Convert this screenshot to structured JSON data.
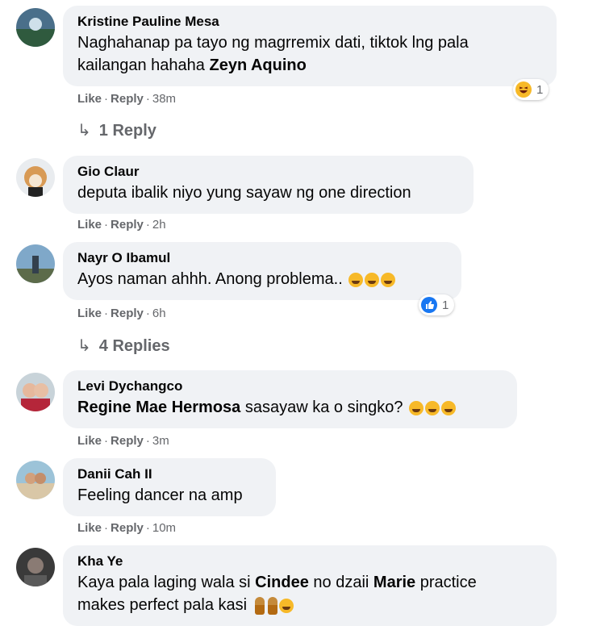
{
  "comments": [
    {
      "author": "Kristine Pauline Mesa",
      "text_line1": "Naghahanap pa tayo ng magrremix dati, tiktok lng pala",
      "text_line2": "kailangan hahaha",
      "mention": "Zeyn Aquino",
      "like": "Like",
      "reply": "Reply",
      "time": "38m",
      "reaction": {
        "icon": "haha-reaction-icon",
        "count": "1"
      },
      "replies": "1 Reply"
    },
    {
      "author": "Gio Claur",
      "text": "deputa ibalik niyo yung sayaw ng one direction",
      "like": "Like",
      "reply": "Reply",
      "time": "2h"
    },
    {
      "author": "Nayr O Ibamul",
      "text": "Ayos naman ahhh. Anong problema..",
      "emojis": [
        "thinking-face",
        "thinking-face",
        "thinking-face"
      ],
      "like": "Like",
      "reply": "Reply",
      "time": "6h",
      "reaction": {
        "icon": "like-reaction-icon",
        "count": "1"
      },
      "replies": "4 Replies"
    },
    {
      "author": "Levi Dychangco",
      "mention": "Regine Mae Hermosa",
      "text": "sasayaw ka o singko?",
      "emojis": [
        "rolling-laughing",
        "rolling-laughing",
        "rolling-laughing"
      ],
      "like": "Like",
      "reply": "Reply",
      "time": "3m"
    },
    {
      "author": "Danii Cah II",
      "text": "Feeling dancer na amp",
      "like": "Like",
      "reply": "Reply",
      "time": "10m"
    },
    {
      "author": "Kha Ye",
      "text_a": "Kaya pala laging wala si",
      "mention1": "Cindee",
      "text_b": "no dzaii",
      "mention2": "Marie",
      "text_c": "practice",
      "text_line2": "makes perfect pala kasi",
      "emojis": [
        "person-gesturing",
        "person-gesturing",
        "eye-roll-face"
      ]
    }
  ],
  "colors": {
    "bubble": "#f0f2f5",
    "meta": "#65676b",
    "like_blue": "#1877f2",
    "haha": "#f7b928"
  }
}
